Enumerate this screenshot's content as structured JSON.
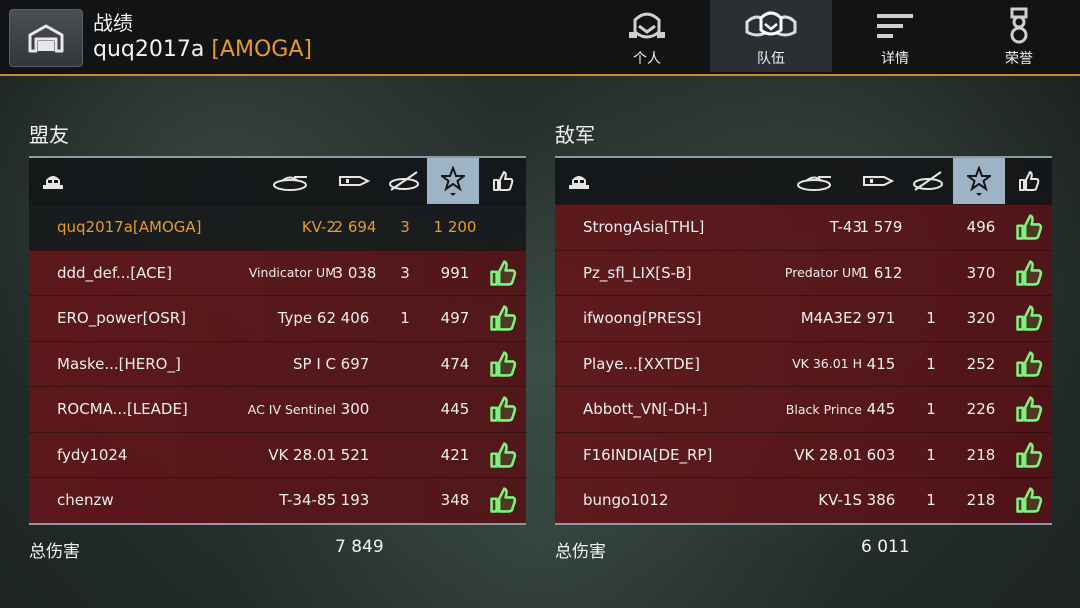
{
  "header": {
    "title": "战绩",
    "player": "quq2017a",
    "clan": "[AMOGA]"
  },
  "tabs": [
    {
      "label": "个人",
      "icon": "helmet-icon",
      "active": false
    },
    {
      "label": "队伍",
      "icon": "team-helmets-icon",
      "active": true
    },
    {
      "label": "详情",
      "icon": "details-lines-icon",
      "active": false
    },
    {
      "label": "荣誉",
      "icon": "medal-icon",
      "active": false
    }
  ],
  "allies": {
    "title": "盟友",
    "rows": [
      {
        "name": "quq2017a[AMOGA]",
        "tank": "KV-2",
        "damage": "2 694",
        "kills": "3",
        "score": "1 200",
        "liked": false,
        "self": true
      },
      {
        "name": "ddd_def...[ACE]",
        "tank": "Vindicator UM",
        "damage": "3 038",
        "kills": "3",
        "score": "991",
        "liked": true
      },
      {
        "name": "ERO_power[OSR]",
        "tank": "Type 62",
        "damage": "406",
        "kills": "1",
        "score": "497",
        "liked": true
      },
      {
        "name": "Maske...[HERO_]",
        "tank": "SP I C",
        "damage": "697",
        "kills": "",
        "score": "474",
        "liked": true
      },
      {
        "name": "ROCMA...[LEADE]",
        "tank": "AC IV Sentinel",
        "damage": "300",
        "kills": "",
        "score": "445",
        "liked": true
      },
      {
        "name": "fydy1024",
        "tank": "VK 28.01",
        "damage": "521",
        "kills": "",
        "score": "421",
        "liked": true
      },
      {
        "name": "chenzw",
        "tank": "T-34-85",
        "damage": "193",
        "kills": "",
        "score": "348",
        "liked": true
      }
    ],
    "total_label": "总伤害",
    "total": "7 849"
  },
  "enemies": {
    "title": "敌军",
    "rows": [
      {
        "name": "StrongAsia[THL]",
        "tank": "T-43",
        "damage": "1 579",
        "kills": "",
        "score": "496",
        "liked": true
      },
      {
        "name": "Pz_sfl_LIX[S-B]",
        "tank": "Predator UM",
        "damage": "1 612",
        "kills": "",
        "score": "370",
        "liked": true
      },
      {
        "name": "ifwoong[PRESS]",
        "tank": "M4A3E2",
        "damage": "971",
        "kills": "1",
        "score": "320",
        "liked": true
      },
      {
        "name": "Playe...[XXTDE]",
        "tank": "VK 36.01 H",
        "damage": "415",
        "kills": "1",
        "score": "252",
        "liked": true
      },
      {
        "name": "Abbott_VN[-DH-]",
        "tank": "Black Prince",
        "damage": "445",
        "kills": "1",
        "score": "226",
        "liked": true
      },
      {
        "name": "F16INDIA[DE_RP]",
        "tank": "VK 28.01",
        "damage": "603",
        "kills": "1",
        "score": "218",
        "liked": true
      },
      {
        "name": "bungo1012",
        "tank": "KV-1S",
        "damage": "386",
        "kills": "1",
        "score": "218",
        "liked": true
      }
    ],
    "total_label": "总伤害",
    "total": "6 011"
  },
  "columns": [
    "player-icon",
    "tank-icon",
    "damage-icon",
    "kills-icon",
    "star-icon",
    "thumbs-up-icon"
  ],
  "colors": {
    "accent": "#e89a2a",
    "like": "#7ef27e",
    "enemy_row": "#621a1e",
    "selected_header": "#9fb3c6"
  }
}
